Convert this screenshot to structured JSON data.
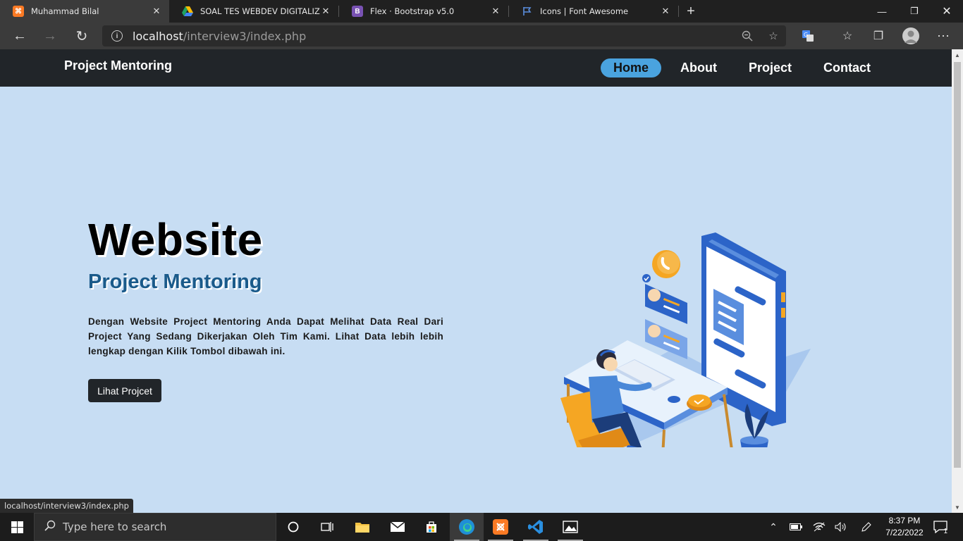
{
  "browser": {
    "tabs": [
      {
        "title": "Muhammad Bilal",
        "favicon": "xampp-icon",
        "active": true
      },
      {
        "title": "SOAL TES WEBDEV DIGITALIZ BA",
        "favicon": "google-drive-icon",
        "active": false
      },
      {
        "title": "Flex · Bootstrap v5.0",
        "favicon": "bootstrap-icon",
        "active": false
      },
      {
        "title": "Icons | Font Awesome",
        "favicon": "font-awesome-flag-icon",
        "active": false
      }
    ],
    "url_host": "localhost",
    "url_path": "/interview3/index.php",
    "status_url": "localhost/interview3/index.php"
  },
  "site": {
    "brand": "Project Mentoring",
    "nav": [
      {
        "label": "Home",
        "active": true
      },
      {
        "label": "About",
        "active": false
      },
      {
        "label": "Project",
        "active": false
      },
      {
        "label": "Contact",
        "active": false
      }
    ],
    "hero": {
      "title": "Website",
      "subtitle": "Project Mentoring",
      "description": "Dengan Website Project Mentoring Anda Dapat Melihat Data Real Dari Project Yang Sedang Dikerjakan Oleh Tim Kami. Lihat Data lebih lebih lengkap dengan Kilik Tombol dibawah ini.",
      "button_label": "Lihat Projcet"
    },
    "colors": {
      "background": "#c7ddf3",
      "navbar": "#212529",
      "accent": "#4aa3df",
      "subtitle": "#1a5a8a"
    }
  },
  "taskbar": {
    "search_placeholder": "Type here to search",
    "time": "8:37 PM",
    "date": "7/22/2022",
    "notification_count": "1"
  }
}
